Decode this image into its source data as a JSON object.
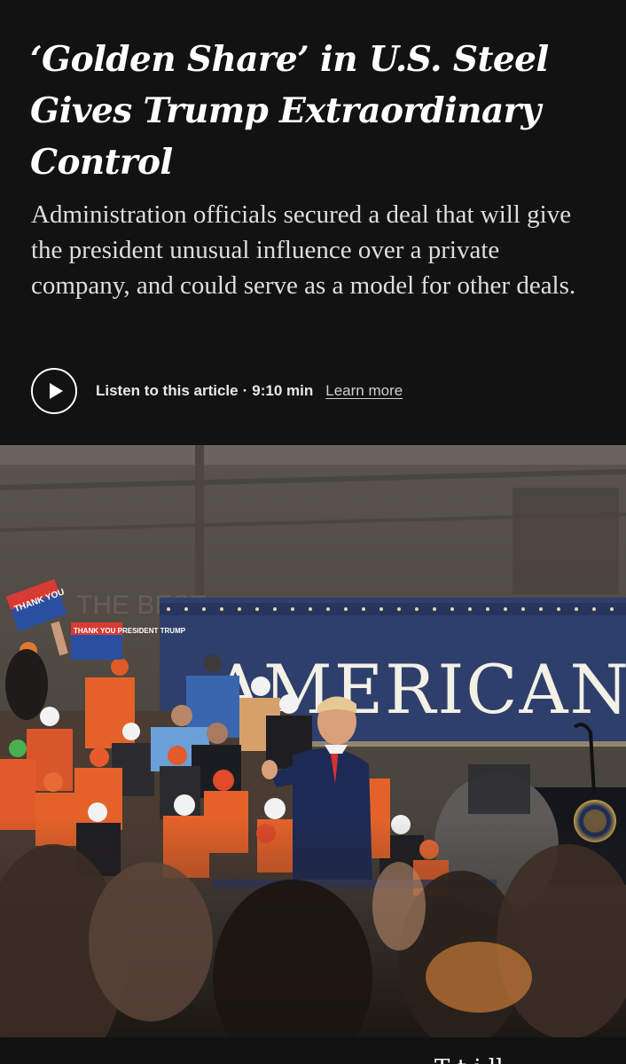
{
  "article": {
    "headline": "‘Golden Share’ in U.S. Steel Gives Trump Extraordinary Control",
    "summary": "Administration officials secured a deal that will give the president unusual influence over a private company, and could serve as a model for other deals.",
    "audio": {
      "label": "Listen to this article",
      "separator": "·",
      "duration": "9:10 min",
      "learn_more": "Learn more",
      "play_icon": "play-icon"
    },
    "photo": {
      "banner_text": "AMERICAN S",
      "sign_left": "THANK YOU",
      "sign_right": "THANK YOU PRESIDENT TRUMP",
      "wall_text": "THE BEST"
    },
    "next_text_fragment": "T   t   i   ll"
  },
  "colors": {
    "background": "#121212",
    "banner": "#2f3f6b",
    "vest_orange": "#e4622a"
  }
}
